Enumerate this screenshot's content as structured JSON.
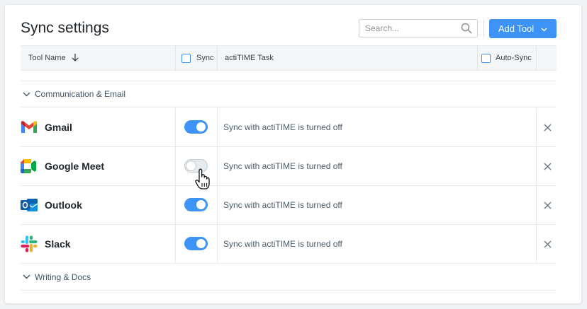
{
  "header": {
    "title": "Sync settings",
    "search_placeholder": "Search...",
    "add_tool_label": "Add Tool"
  },
  "table": {
    "columns": {
      "tool_name": "Tool Name",
      "sync": "Sync",
      "task": "actiTIME Task",
      "auto_sync": "Auto-Sync"
    }
  },
  "groups": [
    {
      "label": "Communication & Email",
      "expanded": true
    },
    {
      "label": "Writing & Docs",
      "expanded": false
    }
  ],
  "rows": [
    {
      "name": "Gmail",
      "icon": "gmail-logo",
      "sync_on": true,
      "status": "Sync with actiTIME is turned off"
    },
    {
      "name": "Google Meet",
      "icon": "google-meet-logo",
      "sync_on": false,
      "status": "Sync with actiTIME is turned off"
    },
    {
      "name": "Outlook",
      "icon": "outlook-logo",
      "sync_on": true,
      "status": "Sync with actiTIME is turned off"
    },
    {
      "name": "Slack",
      "icon": "slack-logo",
      "sync_on": true,
      "status": "Sync with actiTIME is turned off"
    }
  ],
  "colors": {
    "accent": "#3d94f6",
    "toggle_off": "#e6ebef",
    "group_text": "#3f5466"
  }
}
